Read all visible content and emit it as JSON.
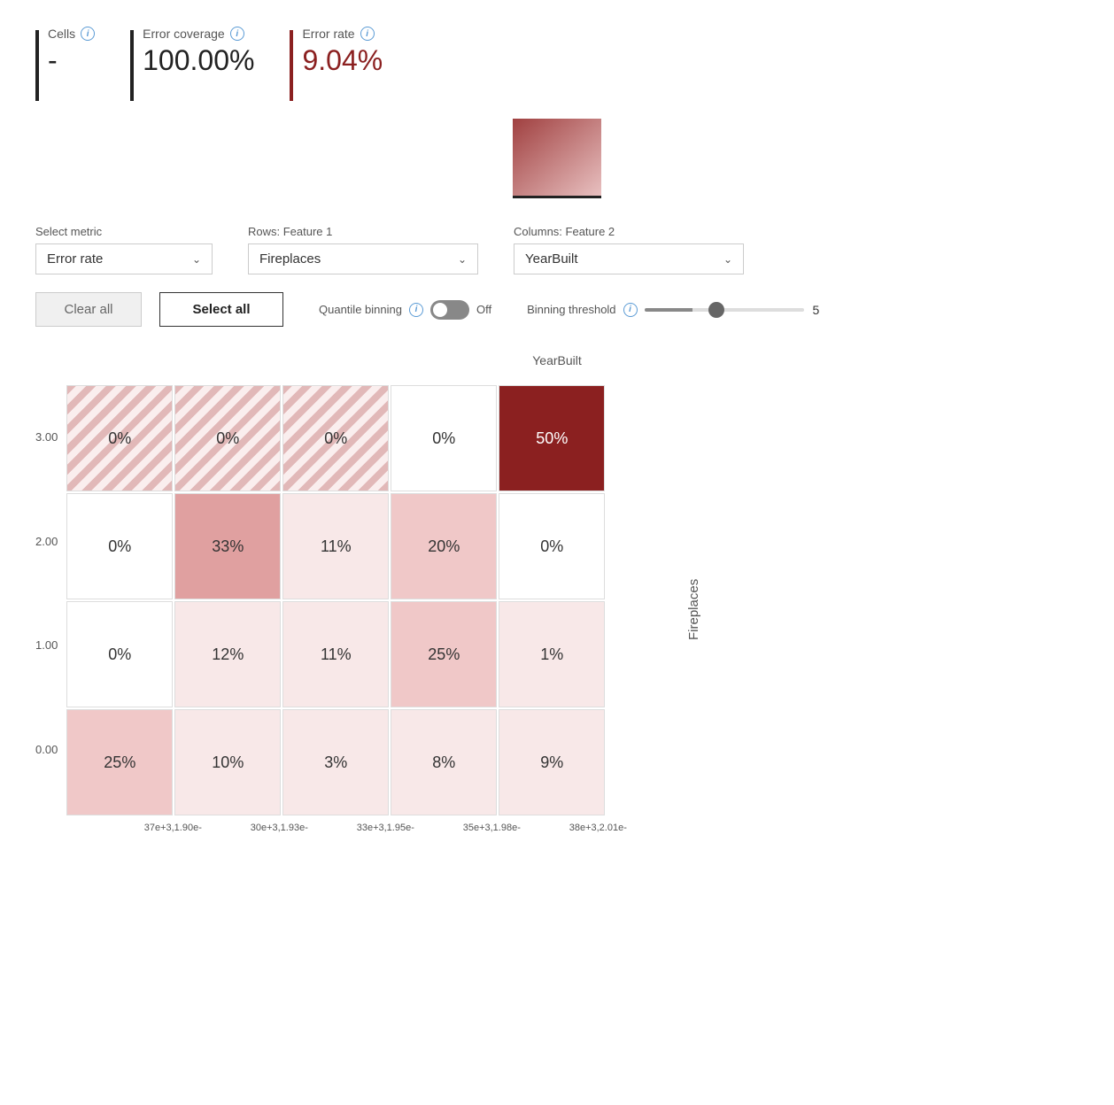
{
  "metrics": {
    "cells": {
      "label": "Cells",
      "value": "-"
    },
    "error_coverage": {
      "label": "Error coverage",
      "value": "100.00%"
    },
    "error_rate": {
      "label": "Error rate",
      "value": "9.04%"
    }
  },
  "controls": {
    "metric_label": "Select metric",
    "metric_value": "Error rate",
    "rows_label": "Rows: Feature 1",
    "rows_value": "Fireplaces",
    "columns_label": "Columns: Feature 2",
    "columns_value": "YearBuilt",
    "clear_all": "Clear all",
    "select_all": "Select all",
    "quantile_label": "Quantile binning",
    "quantile_state": "Off",
    "binning_label": "Binning threshold",
    "binning_value": "5"
  },
  "heatmap": {
    "title": "YearBuilt",
    "row_label": "Fireplaces",
    "y_labels": [
      "3.00",
      "2.00",
      "1.00",
      "0.00"
    ],
    "x_labels": [
      "37e+3,1.90e-",
      "30e+3,1.93e-",
      "33e+3,1.95e-",
      "35e+3,1.98e-",
      "38e+3,2.01e-"
    ],
    "cells": [
      {
        "row": 0,
        "col": 0,
        "value": "0%",
        "type": "striped"
      },
      {
        "row": 0,
        "col": 1,
        "value": "0%",
        "type": "striped"
      },
      {
        "row": 0,
        "col": 2,
        "value": "0%",
        "type": "striped"
      },
      {
        "row": 0,
        "col": 3,
        "value": "0%",
        "type": "white"
      },
      {
        "row": 0,
        "col": 4,
        "value": "50%",
        "type": "dark"
      },
      {
        "row": 1,
        "col": 0,
        "value": "0%",
        "type": "white"
      },
      {
        "row": 1,
        "col": 1,
        "value": "33%",
        "type": "medium"
      },
      {
        "row": 1,
        "col": 2,
        "value": "11%",
        "type": "light"
      },
      {
        "row": 1,
        "col": 3,
        "value": "20%",
        "type": "medium-light"
      },
      {
        "row": 1,
        "col": 4,
        "value": "0%",
        "type": "white"
      },
      {
        "row": 2,
        "col": 0,
        "value": "0%",
        "type": "white"
      },
      {
        "row": 2,
        "col": 1,
        "value": "12%",
        "type": "light"
      },
      {
        "row": 2,
        "col": 2,
        "value": "11%",
        "type": "light"
      },
      {
        "row": 2,
        "col": 3,
        "value": "25%",
        "type": "medium-light"
      },
      {
        "row": 2,
        "col": 4,
        "value": "1%",
        "type": "light"
      },
      {
        "row": 3,
        "col": 0,
        "value": "25%",
        "type": "medium-light"
      },
      {
        "row": 3,
        "col": 1,
        "value": "10%",
        "type": "light"
      },
      {
        "row": 3,
        "col": 2,
        "value": "3%",
        "type": "light"
      },
      {
        "row": 3,
        "col": 3,
        "value": "8%",
        "type": "light"
      },
      {
        "row": 3,
        "col": 4,
        "value": "9%",
        "type": "light"
      }
    ]
  }
}
